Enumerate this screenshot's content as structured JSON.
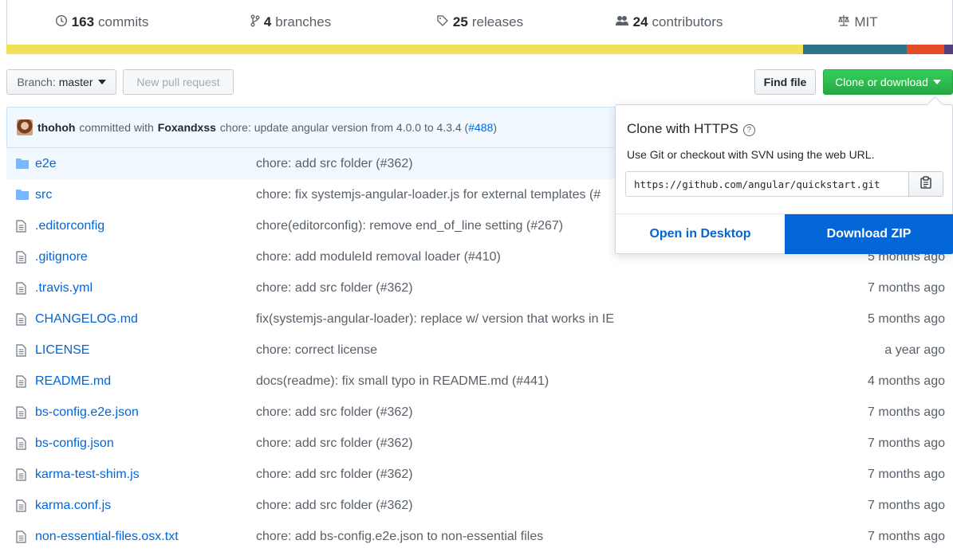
{
  "stats": {
    "commits": {
      "num": "163",
      "label": "commits"
    },
    "branches": {
      "num": "4",
      "label": "branches"
    },
    "releases": {
      "num": "25",
      "label": "releases"
    },
    "contributors": {
      "num": "24",
      "label": "contributors"
    },
    "license": {
      "label": "MIT"
    }
  },
  "language_bar": [
    {
      "color": "#f1e05a",
      "fraction": 0.842
    },
    {
      "color": "#2b7489",
      "fraction": 0.109
    },
    {
      "color": "#e34c26",
      "fraction": 0.04
    },
    {
      "color": "#563d7c",
      "fraction": 0.009
    }
  ],
  "toolbar": {
    "branch_prefix": "Branch:",
    "branch_name": "master",
    "new_pr": "New pull request",
    "find_file": "Find file",
    "clone_download": "Clone or download"
  },
  "commit": {
    "author": "thohoh",
    "committed_with": "committed with",
    "committer": "Foxandxss",
    "message": "chore: update angular version from 4.0.0 to 4.3.4 (",
    "pr": "#488",
    "close": ")"
  },
  "files": [
    {
      "type": "dir",
      "name": "e2e",
      "message": "chore: add src folder (#362)",
      "age": ""
    },
    {
      "type": "dir",
      "name": "src",
      "message": "chore: fix systemjs-angular-loader.js for external templates (#",
      "age": ""
    },
    {
      "type": "file",
      "name": ".editorconfig",
      "message": "chore(editorconfig): remove end_of_line setting (#267)",
      "age": ""
    },
    {
      "type": "file",
      "name": ".gitignore",
      "message": "chore: add moduleId removal loader (#410)",
      "age": "5 months ago"
    },
    {
      "type": "file",
      "name": ".travis.yml",
      "message": "chore: add src folder (#362)",
      "age": "7 months ago"
    },
    {
      "type": "file",
      "name": "CHANGELOG.md",
      "message": "fix(systemjs-angular-loader): replace w/ version that works in IE",
      "age": "5 months ago"
    },
    {
      "type": "file",
      "name": "LICENSE",
      "message": "chore: correct license",
      "age": "a year ago"
    },
    {
      "type": "file",
      "name": "README.md",
      "message": "docs(readme): fix small typo in README.md (#441)",
      "age": "4 months ago"
    },
    {
      "type": "file",
      "name": "bs-config.e2e.json",
      "message": "chore: add src folder (#362)",
      "age": "7 months ago"
    },
    {
      "type": "file",
      "name": "bs-config.json",
      "message": "chore: add src folder (#362)",
      "age": "7 months ago"
    },
    {
      "type": "file",
      "name": "karma-test-shim.js",
      "message": "chore: add src folder (#362)",
      "age": "7 months ago"
    },
    {
      "type": "file",
      "name": "karma.conf.js",
      "message": "chore: add src folder (#362)",
      "age": "7 months ago"
    },
    {
      "type": "file",
      "name": "non-essential-files.osx.txt",
      "message": "chore: add bs-config.e2e.json to non-essential files",
      "age": "7 months ago"
    }
  ],
  "clone": {
    "title": "Clone with HTTPS",
    "help_icon": "?",
    "description": "Use Git or checkout with SVN using the web URL.",
    "url": "https://github.com/angular/quickstart.git",
    "open_desktop": "Open in Desktop",
    "download_zip": "Download ZIP"
  }
}
